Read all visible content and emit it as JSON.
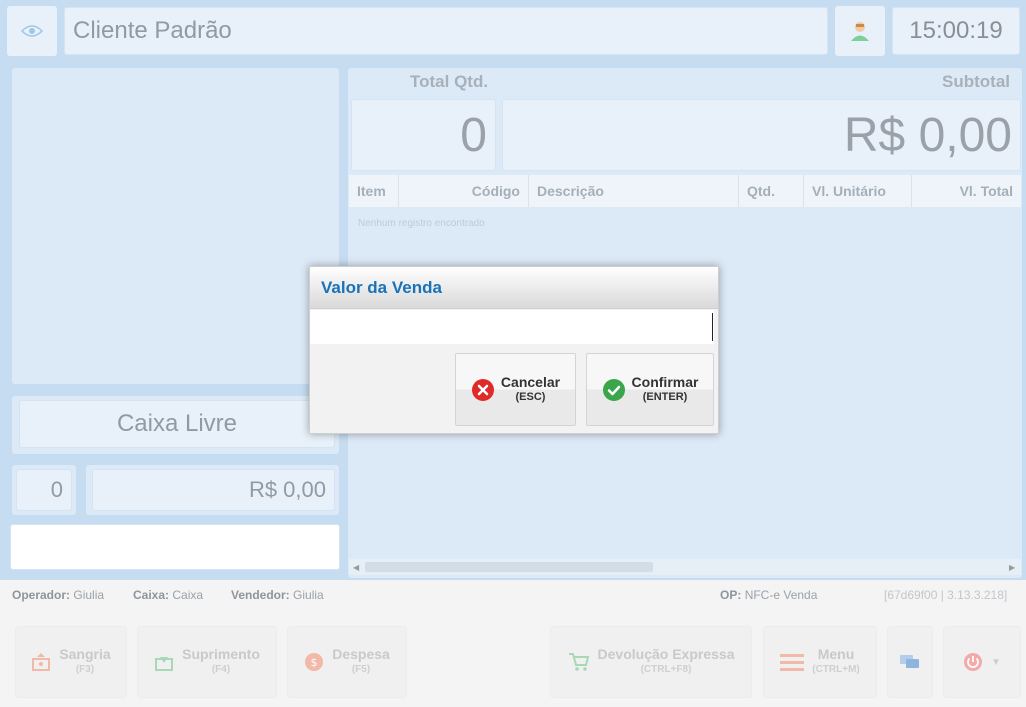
{
  "header": {
    "client_name": "Cliente Padrão",
    "clock": "15:00:19"
  },
  "left": {
    "status": "Caixa Livre",
    "qty": "0",
    "amount": "R$ 0,00"
  },
  "summary": {
    "total_qty_label": "Total Qtd.",
    "subtotal_label": "Subtotal",
    "total_qty": "0",
    "subtotal": "R$ 0,00"
  },
  "table": {
    "columns": [
      "Item",
      "Código",
      "Descrição",
      "Qtd.",
      "Vl. Unitário",
      "Vl. Total"
    ],
    "empty_message": "Nenhum registro encontrado"
  },
  "statusbar": {
    "operator_label": "Operador:",
    "operator": "Giulia",
    "caixa_label": "Caixa:",
    "caixa": "Caixa",
    "seller_label": "Vendedor:",
    "seller": "Giulia",
    "op_label": "OP:",
    "op": "NFC-e Venda",
    "version": "[67d69f00 | 3.13.3.218]"
  },
  "footer": {
    "sangria": {
      "label": "Sangria",
      "key": "(F3)"
    },
    "suprimento": {
      "label": "Suprimento",
      "key": "(F4)"
    },
    "despesa": {
      "label": "Despesa",
      "key": "(F5)"
    },
    "devolucao": {
      "label": "Devolução Expressa",
      "key": "(CTRL+F8)"
    },
    "menu": {
      "label": "Menu",
      "key": "(CTRL+M)"
    }
  },
  "modal": {
    "title": "Valor da Venda",
    "input_value": "",
    "cancel": {
      "label": "Cancelar",
      "key": "(ESC)"
    },
    "confirm": {
      "label": "Confirmar",
      "key": "(ENTER)"
    }
  },
  "colors": {
    "accent": "#1a73b8",
    "cancel": "#e02a2a",
    "confirm": "#3aa54a"
  }
}
